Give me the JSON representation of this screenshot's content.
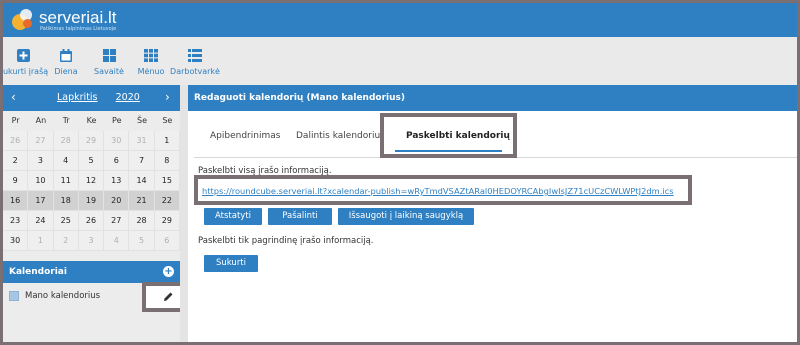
{
  "brand": {
    "name": "serveriai.lt",
    "tagline": "Patikimas talpinimas Lietuvoje",
    "colors": {
      "primary": "#2f80c3",
      "frame": "#7a6f72",
      "highlight": "#d1d1d1"
    }
  },
  "toolbar": {
    "items": [
      {
        "label": "Sukurti įrašą",
        "icon": "plus-square-icon"
      },
      {
        "label": "Diena",
        "icon": "calendar-icon"
      },
      {
        "label": "Savaitė",
        "icon": "grid-4-icon"
      },
      {
        "label": "Mėnuo",
        "icon": "grid-9-icon"
      },
      {
        "label": "Darbotvarkė",
        "icon": "list-icon"
      }
    ]
  },
  "calendar": {
    "prev": "‹",
    "next": "›",
    "month": "Lapkritis",
    "year": "2020",
    "weekdays": [
      "Pr",
      "An",
      "Tr",
      "Ke",
      "Pe",
      "Še",
      "Se"
    ],
    "weeks": [
      [
        "26",
        "27",
        "28",
        "29",
        "30",
        "31",
        "1"
      ],
      [
        "2",
        "3",
        "4",
        "5",
        "6",
        "7",
        "8"
      ],
      [
        "9",
        "10",
        "11",
        "12",
        "13",
        "14",
        "15"
      ],
      [
        "16",
        "17",
        "18",
        "19",
        "20",
        "21",
        "22"
      ],
      [
        "23",
        "24",
        "25",
        "26",
        "27",
        "28",
        "29"
      ],
      [
        "30",
        "1",
        "2",
        "3",
        "4",
        "5",
        "6"
      ]
    ]
  },
  "calendars": {
    "title": "Kalendoriai",
    "add": "+",
    "items": [
      {
        "label": "Mano kalendorius"
      }
    ]
  },
  "main": {
    "title": "Redaguoti kalendorių (Mano kalendorius)",
    "tabs": [
      "Apibendrinimas",
      "Dalintis kalendoriumi",
      "Paskelbti kalendorių"
    ],
    "publish_full_label": "Paskelbti visą įrašo informaciją.",
    "publish_url": "https://roundcube.serveriai.lt?xcalendar-publish=wRyTmdVSAZtARal0HEDOYRCAbgIwIsJZ71cUCzCWLWPtJ2dm.ics",
    "buttons": {
      "reset": "Atstatyti",
      "delete": "Pašalinti",
      "save": "Išsaugoti į laikiną saugyklą"
    },
    "publish_basic_label": "Paskelbti tik pagrindinę įrašo informaciją.",
    "create": "Sukurti"
  }
}
